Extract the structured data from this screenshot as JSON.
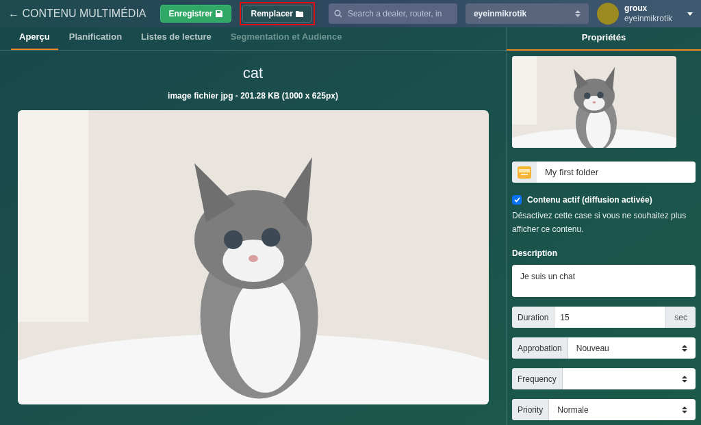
{
  "header": {
    "back_icon": "←",
    "back_title": "CONTENU MULTIMÉDIA",
    "buttons": [
      {
        "label": "Enregistrer",
        "kind": "save",
        "highlighted": false
      },
      {
        "label": "Remplacer",
        "kind": "replace",
        "highlighted": true
      }
    ],
    "search": {
      "placeholder": "Search a dealer, router, in"
    },
    "org_select": {
      "value": "eyeinmikrotik"
    },
    "user": {
      "name": "groux",
      "org": "eyeinmikrotik"
    }
  },
  "tabs": [
    {
      "label": "Aperçu",
      "selected": true,
      "disabled": false
    },
    {
      "label": "Planification",
      "selected": false,
      "disabled": false
    },
    {
      "label": "Listes de lecture",
      "selected": false,
      "disabled": false
    },
    {
      "label": "Segmentation et Audience",
      "selected": false,
      "disabled": true
    }
  ],
  "preview": {
    "title": "cat",
    "subtitle": "image fichier jpg - 201.28 KB (1000 x 625px)"
  },
  "properties": {
    "tab": "Propriétés",
    "folder": "My first folder",
    "active": {
      "label": "Contenu actif (diffusion activée)",
      "checked": true,
      "help": "Désactivez cette case si vous ne souhaitez plus afficher ce contenu."
    },
    "description": {
      "label": "Description",
      "value": "Je suis un chat"
    },
    "fields": [
      {
        "kind": "input",
        "label": "Duration",
        "value": "15",
        "suffix": "sec"
      },
      {
        "kind": "select",
        "label": "Approbation",
        "value": "Nouveau"
      },
      {
        "kind": "select",
        "label": "Frequency"
      },
      {
        "kind": "select",
        "label": "Priority",
        "value": "Normale"
      }
    ]
  }
}
